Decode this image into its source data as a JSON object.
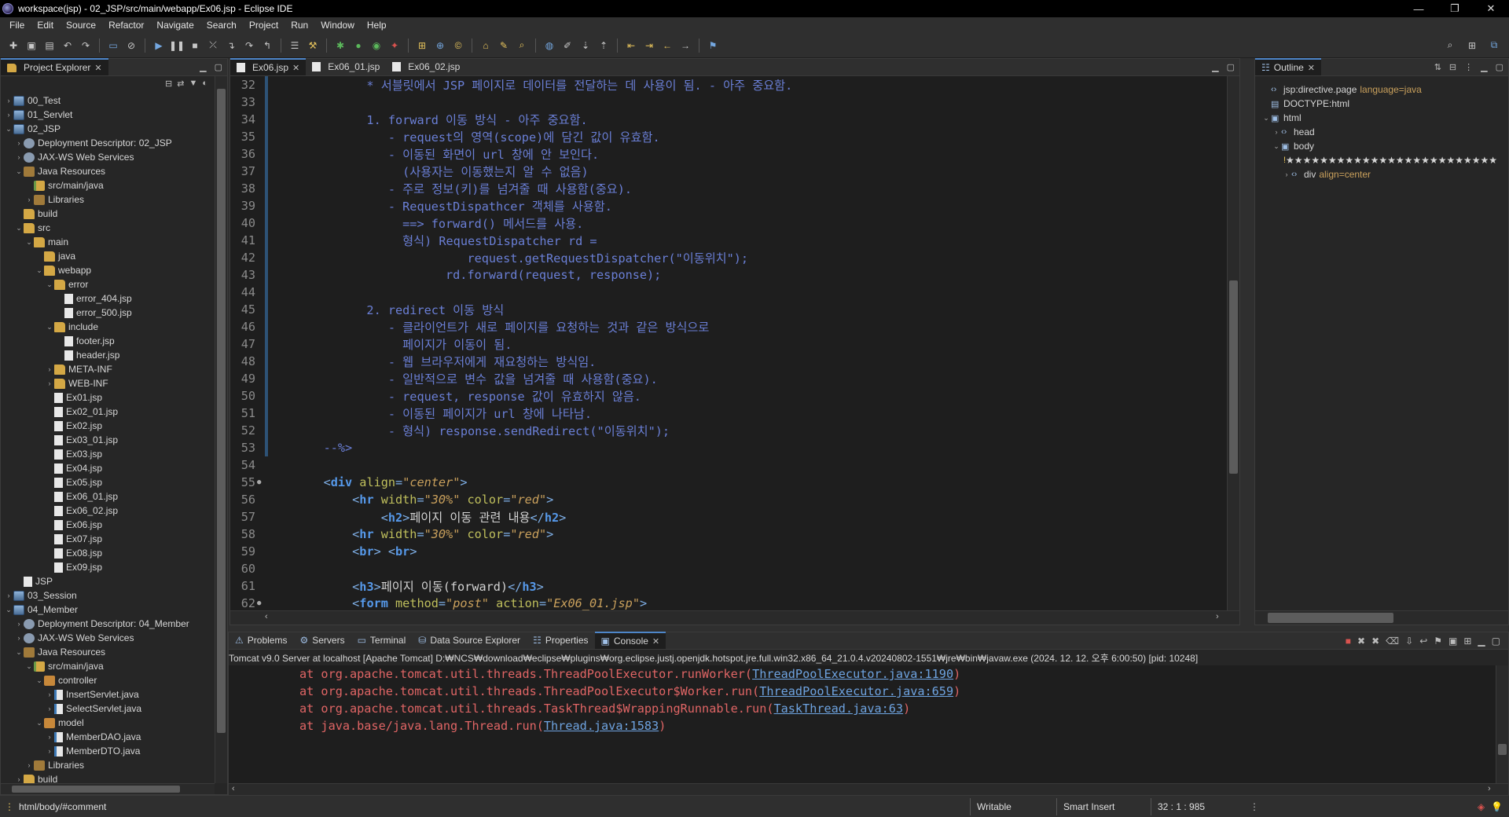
{
  "window": {
    "title": "workspace(jsp) - 02_JSP/src/main/webapp/Ex06.jsp - Eclipse IDE"
  },
  "menu": [
    "File",
    "Edit",
    "Source",
    "Refactor",
    "Navigate",
    "Search",
    "Project",
    "Run",
    "Window",
    "Help"
  ],
  "explorer": {
    "tab_label": "Project Explorer",
    "items": [
      {
        "label": "00_Test",
        "depth": 0,
        "arrow": "›",
        "icon": "project"
      },
      {
        "label": "01_Servlet",
        "depth": 0,
        "arrow": "›",
        "icon": "project"
      },
      {
        "label": "02_JSP",
        "depth": 0,
        "arrow": "⌄",
        "icon": "project"
      },
      {
        "label": "Deployment Descriptor: 02_JSP",
        "depth": 1,
        "arrow": "›",
        "icon": "dd"
      },
      {
        "label": "JAX-WS Web Services",
        "depth": 1,
        "arrow": "›",
        "icon": "dd"
      },
      {
        "label": "Java Resources",
        "depth": 1,
        "arrow": "⌄",
        "icon": "lib"
      },
      {
        "label": "src/main/java",
        "depth": 2,
        "arrow": "",
        "icon": "src"
      },
      {
        "label": "Libraries",
        "depth": 2,
        "arrow": "›",
        "icon": "lib"
      },
      {
        "label": "build",
        "depth": 1,
        "arrow": "",
        "icon": "folder"
      },
      {
        "label": "src",
        "depth": 1,
        "arrow": "⌄",
        "icon": "folder"
      },
      {
        "label": "main",
        "depth": 2,
        "arrow": "⌄",
        "icon": "folder"
      },
      {
        "label": "java",
        "depth": 3,
        "arrow": "",
        "icon": "folder"
      },
      {
        "label": "webapp",
        "depth": 3,
        "arrow": "⌄",
        "icon": "folder"
      },
      {
        "label": "error",
        "depth": 4,
        "arrow": "⌄",
        "icon": "folder"
      },
      {
        "label": "error_404.jsp",
        "depth": 5,
        "arrow": "",
        "icon": "file"
      },
      {
        "label": "error_500.jsp",
        "depth": 5,
        "arrow": "",
        "icon": "file"
      },
      {
        "label": "include",
        "depth": 4,
        "arrow": "⌄",
        "icon": "folder"
      },
      {
        "label": "footer.jsp",
        "depth": 5,
        "arrow": "",
        "icon": "file"
      },
      {
        "label": "header.jsp",
        "depth": 5,
        "arrow": "",
        "icon": "file"
      },
      {
        "label": "META-INF",
        "depth": 4,
        "arrow": "›",
        "icon": "folder"
      },
      {
        "label": "WEB-INF",
        "depth": 4,
        "arrow": "›",
        "icon": "folder"
      },
      {
        "label": "Ex01.jsp",
        "depth": 4,
        "arrow": "",
        "icon": "file"
      },
      {
        "label": "Ex02_01.jsp",
        "depth": 4,
        "arrow": "",
        "icon": "file"
      },
      {
        "label": "Ex02.jsp",
        "depth": 4,
        "arrow": "",
        "icon": "file"
      },
      {
        "label": "Ex03_01.jsp",
        "depth": 4,
        "arrow": "",
        "icon": "file"
      },
      {
        "label": "Ex03.jsp",
        "depth": 4,
        "arrow": "",
        "icon": "file"
      },
      {
        "label": "Ex04.jsp",
        "depth": 4,
        "arrow": "",
        "icon": "file"
      },
      {
        "label": "Ex05.jsp",
        "depth": 4,
        "arrow": "",
        "icon": "file"
      },
      {
        "label": "Ex06_01.jsp",
        "depth": 4,
        "arrow": "",
        "icon": "file"
      },
      {
        "label": "Ex06_02.jsp",
        "depth": 4,
        "arrow": "",
        "icon": "file"
      },
      {
        "label": "Ex06.jsp",
        "depth": 4,
        "arrow": "",
        "icon": "file"
      },
      {
        "label": "Ex07.jsp",
        "depth": 4,
        "arrow": "",
        "icon": "file"
      },
      {
        "label": "Ex08.jsp",
        "depth": 4,
        "arrow": "",
        "icon": "file"
      },
      {
        "label": "Ex09.jsp",
        "depth": 4,
        "arrow": "",
        "icon": "file"
      },
      {
        "label": "JSP",
        "depth": 1,
        "arrow": "",
        "icon": "file"
      },
      {
        "label": "03_Session",
        "depth": 0,
        "arrow": "›",
        "icon": "project"
      },
      {
        "label": "04_Member",
        "depth": 0,
        "arrow": "⌄",
        "icon": "project"
      },
      {
        "label": "Deployment Descriptor: 04_Member",
        "depth": 1,
        "arrow": "›",
        "icon": "dd"
      },
      {
        "label": "JAX-WS Web Services",
        "depth": 1,
        "arrow": "›",
        "icon": "dd"
      },
      {
        "label": "Java Resources",
        "depth": 1,
        "arrow": "⌄",
        "icon": "lib"
      },
      {
        "label": "src/main/java",
        "depth": 2,
        "arrow": "⌄",
        "icon": "src"
      },
      {
        "label": "controller",
        "depth": 3,
        "arrow": "⌄",
        "icon": "pkg"
      },
      {
        "label": "InsertServlet.java",
        "depth": 4,
        "arrow": "›",
        "icon": "java"
      },
      {
        "label": "SelectServlet.java",
        "depth": 4,
        "arrow": "›",
        "icon": "java"
      },
      {
        "label": "model",
        "depth": 3,
        "arrow": "⌄",
        "icon": "pkg"
      },
      {
        "label": "MemberDAO.java",
        "depth": 4,
        "arrow": "›",
        "icon": "java"
      },
      {
        "label": "MemberDTO.java",
        "depth": 4,
        "arrow": "›",
        "icon": "java"
      },
      {
        "label": "Libraries",
        "depth": 2,
        "arrow": "›",
        "icon": "lib"
      },
      {
        "label": "build",
        "depth": 1,
        "arrow": "›",
        "icon": "folder"
      }
    ]
  },
  "editor": {
    "tabs": [
      {
        "label": "Ex06.jsp",
        "active": true
      },
      {
        "label": "Ex06_01.jsp",
        "active": false
      },
      {
        "label": "Ex06_02.jsp",
        "active": false
      }
    ],
    "lines": [
      {
        "n": "32",
        "mark": "",
        "segs": [
          [
            "c-com",
            "          * 서블릿에서 JSP 페이지로 데이터를 전달하는 데 사용이 됨. - 아주 중요함."
          ]
        ]
      },
      {
        "n": "33",
        "mark": "",
        "segs": []
      },
      {
        "n": "34",
        "mark": "",
        "segs": [
          [
            "c-com",
            "          1. forward 이동 방식 - 아주 중요함."
          ]
        ]
      },
      {
        "n": "35",
        "mark": "",
        "segs": [
          [
            "c-com",
            "             - request의 영역(scope)에 담긴 값이 유효함."
          ]
        ]
      },
      {
        "n": "36",
        "mark": "",
        "segs": [
          [
            "c-com",
            "             - 이동된 화면이 url 창에 안 보인다."
          ]
        ]
      },
      {
        "n": "37",
        "mark": "",
        "segs": [
          [
            "c-com",
            "               (사용자는 이동했는지 알 수 없음)"
          ]
        ]
      },
      {
        "n": "38",
        "mark": "",
        "segs": [
          [
            "c-com",
            "             - 주로 정보(키)를 넘겨줄 때 사용함(중요)."
          ]
        ]
      },
      {
        "n": "39",
        "mark": "",
        "segs": [
          [
            "c-com",
            "             - RequestDispathcer 객체를 사용함."
          ]
        ]
      },
      {
        "n": "40",
        "mark": "",
        "segs": [
          [
            "c-com",
            "               ==> forward() 메서드를 사용."
          ]
        ]
      },
      {
        "n": "41",
        "mark": "",
        "segs": [
          [
            "c-com",
            "               형식) RequestDispatcher rd ="
          ]
        ]
      },
      {
        "n": "42",
        "mark": "",
        "segs": [
          [
            "c-com",
            "                        request.getRequestDispatcher(\"이동위치\");"
          ]
        ]
      },
      {
        "n": "43",
        "mark": "",
        "segs": [
          [
            "c-com",
            "                     rd.forward(request, response);"
          ]
        ]
      },
      {
        "n": "44",
        "mark": "",
        "segs": []
      },
      {
        "n": "45",
        "mark": "",
        "segs": [
          [
            "c-com",
            "          2. redirect 이동 방식"
          ]
        ]
      },
      {
        "n": "46",
        "mark": "",
        "segs": [
          [
            "c-com",
            "             - 클라이언트가 새로 페이지를 요청하는 것과 같은 방식으로"
          ]
        ]
      },
      {
        "n": "47",
        "mark": "",
        "segs": [
          [
            "c-com",
            "               페이지가 이동이 됨."
          ]
        ]
      },
      {
        "n": "48",
        "mark": "",
        "segs": [
          [
            "c-com",
            "             - 웹 브라우저에게 재요청하는 방식임."
          ]
        ]
      },
      {
        "n": "49",
        "mark": "",
        "segs": [
          [
            "c-com",
            "             - 일반적으로 변수 값을 넘겨줄 때 사용함(중요)."
          ]
        ]
      },
      {
        "n": "50",
        "mark": "",
        "segs": [
          [
            "c-com",
            "             - request, response 값이 유효하지 않음."
          ]
        ]
      },
      {
        "n": "51",
        "mark": "",
        "segs": [
          [
            "c-com",
            "             - 이동된 페이지가 url 창에 나타남."
          ]
        ]
      },
      {
        "n": "52",
        "mark": "",
        "segs": [
          [
            "c-com",
            "             - 형식) response.sendRedirect(\"이동위치\");"
          ]
        ]
      },
      {
        "n": "53",
        "mark": "",
        "segs": [
          [
            "c-com",
            "    --%>"
          ]
        ]
      },
      {
        "n": "54",
        "mark": "",
        "segs": []
      },
      {
        "n": "55",
        "mark": "●",
        "segs": [
          [
            "c-tag",
            "    <"
          ],
          [
            "c-tagn",
            "div"
          ],
          [
            "c-attr",
            " align"
          ],
          [
            "c-tag",
            "="
          ],
          [
            "c-val",
            "\"center\""
          ],
          [
            "c-tag",
            ">"
          ]
        ]
      },
      {
        "n": "56",
        "mark": "",
        "segs": [
          [
            "c-tag",
            "        <"
          ],
          [
            "c-tagn",
            "hr"
          ],
          [
            "c-attr",
            " width"
          ],
          [
            "c-tag",
            "="
          ],
          [
            "c-val",
            "\"30%\""
          ],
          [
            "c-attr",
            " color"
          ],
          [
            "c-tag",
            "="
          ],
          [
            "c-val",
            "\"red\""
          ],
          [
            "c-tag",
            ">"
          ]
        ]
      },
      {
        "n": "57",
        "mark": "",
        "segs": [
          [
            "c-tag",
            "            <"
          ],
          [
            "c-tagn",
            "h2"
          ],
          [
            "c-tag",
            ">"
          ],
          [
            "c-txt",
            "페이지 이동 관련 내용"
          ],
          [
            "c-tag",
            "</"
          ],
          [
            "c-tagn",
            "h2"
          ],
          [
            "c-tag",
            ">"
          ]
        ]
      },
      {
        "n": "58",
        "mark": "",
        "segs": [
          [
            "c-tag",
            "        <"
          ],
          [
            "c-tagn",
            "hr"
          ],
          [
            "c-attr",
            " width"
          ],
          [
            "c-tag",
            "="
          ],
          [
            "c-val",
            "\"30%\""
          ],
          [
            "c-attr",
            " color"
          ],
          [
            "c-tag",
            "="
          ],
          [
            "c-val",
            "\"red\""
          ],
          [
            "c-tag",
            ">"
          ]
        ]
      },
      {
        "n": "59",
        "mark": "",
        "segs": [
          [
            "c-tag",
            "        <"
          ],
          [
            "c-tagn",
            "br"
          ],
          [
            "c-tag",
            "> <"
          ],
          [
            "c-tagn",
            "br"
          ],
          [
            "c-tag",
            ">"
          ]
        ]
      },
      {
        "n": "60",
        "mark": "",
        "segs": []
      },
      {
        "n": "61",
        "mark": "",
        "segs": [
          [
            "c-tag",
            "        <"
          ],
          [
            "c-tagn",
            "h3"
          ],
          [
            "c-tag",
            ">"
          ],
          [
            "c-txt",
            "페이지 이동(forward)"
          ],
          [
            "c-tag",
            "</"
          ],
          [
            "c-tagn",
            "h3"
          ],
          [
            "c-tag",
            ">"
          ]
        ]
      },
      {
        "n": "62",
        "mark": "●",
        "segs": [
          [
            "c-tag",
            "        <"
          ],
          [
            "c-tagn",
            "form"
          ],
          [
            "c-attr",
            " method"
          ],
          [
            "c-tag",
            "="
          ],
          [
            "c-val",
            "\"post\""
          ],
          [
            "c-attr",
            " action"
          ],
          [
            "c-tag",
            "="
          ],
          [
            "c-val",
            "\"Ex06_01.jsp\""
          ],
          [
            "c-tag",
            ">"
          ]
        ]
      }
    ]
  },
  "outline": {
    "tab_label": "Outline",
    "items": [
      {
        "label": "jsp:directive.page",
        "attr": "language=java",
        "depth": 0,
        "arrow": "",
        "icon": "‹›"
      },
      {
        "label": "DOCTYPE:html",
        "attr": "",
        "depth": 0,
        "arrow": "",
        "icon": "▤"
      },
      {
        "label": "html",
        "attr": "",
        "depth": 0,
        "arrow": "⌄",
        "icon": "▣"
      },
      {
        "label": "head",
        "attr": "",
        "depth": 1,
        "arrow": "›",
        "icon": "‹›"
      },
      {
        "label": "body",
        "attr": "",
        "depth": 1,
        "arrow": "⌄",
        "icon": "▣"
      },
      {
        "label": "★★★★★★★★★★★★★★★★★★★★★★★★★",
        "attr": "",
        "depth": 2,
        "arrow": "",
        "icon": "!"
      },
      {
        "label": "div",
        "attr": "align=center",
        "depth": 2,
        "arrow": "›",
        "icon": "‹›"
      }
    ]
  },
  "console": {
    "tabs": [
      "Problems",
      "Servers",
      "Terminal",
      "Data Source Explorer",
      "Properties",
      "Console"
    ],
    "active_tab": "Console",
    "header": "Tomcat v9.0 Server at localhost [Apache Tomcat] D:₩NCS₩download₩eclipse₩plugins₩org.eclipse.justj.openjdk.hotspot.jre.full.win32.x86_64_21.0.4.v20240802-1551₩jre₩bin₩javaw.exe  (2024. 12. 12. 오후 6:00:50) [pid: 10248]",
    "lines": [
      {
        "prefix": "at org.apache.tomcat.util.threads.ThreadPoolExecutor.runWorker(",
        "link": "ThreadPoolExecutor.java:1190",
        "suffix": ")"
      },
      {
        "prefix": "at org.apache.tomcat.util.threads.ThreadPoolExecutor$Worker.run(",
        "link": "ThreadPoolExecutor.java:659",
        "suffix": ")"
      },
      {
        "prefix": "at org.apache.tomcat.util.threads.TaskThread$WrappingRunnable.run(",
        "link": "TaskThread.java:63",
        "suffix": ")"
      },
      {
        "prefix": "at java.base/java.lang.Thread.run(",
        "link": "Thread.java:1583",
        "suffix": ")"
      }
    ]
  },
  "status": {
    "path": "html/body/#comment",
    "mode": "Writable",
    "insert": "Smart Insert",
    "position": "32 : 1 : 985"
  }
}
